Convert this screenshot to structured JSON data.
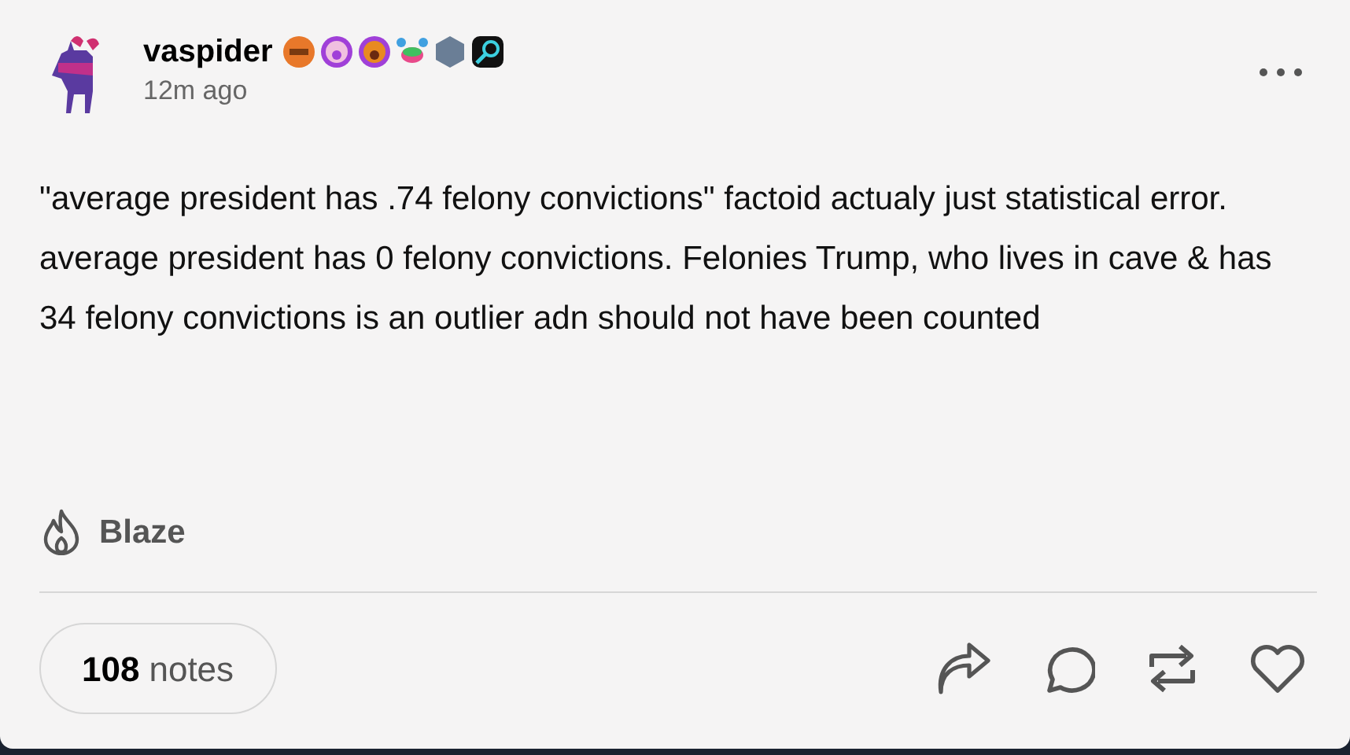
{
  "post": {
    "author": "vaspider",
    "time": "12m ago",
    "body": "\"average president has .74 felony convictions\" factoid actualy just statistical error. average president has 0 felony convictions. Felonies Trump, who lives in cave & has 34 felony convictions is an outlier adn should not have been counted"
  },
  "blaze": {
    "label": "Blaze"
  },
  "notes": {
    "count": "108",
    "label": "notes"
  }
}
